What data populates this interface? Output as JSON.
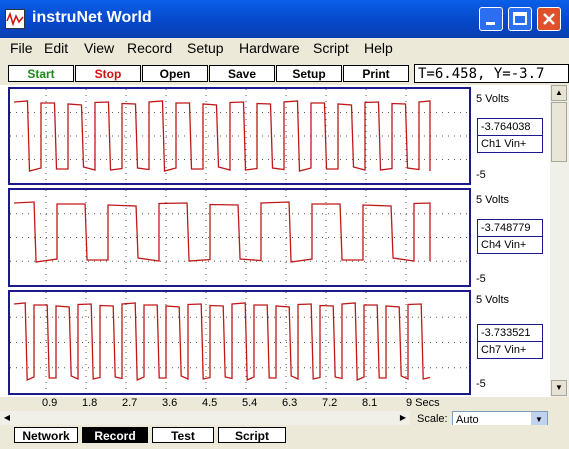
{
  "window": {
    "title": "instruNet World"
  },
  "menu": [
    "File",
    "Edit",
    "View",
    "Record",
    "Setup",
    "Hardware",
    "Script",
    "Help"
  ],
  "toolbar": {
    "buttons": [
      "Start",
      "Stop",
      "Open",
      "Save",
      "Setup",
      "Print"
    ],
    "colors": {
      "start": "#1a8c1a",
      "stop": "#d01010"
    }
  },
  "status_readout": "T=6.458, Y=-3.7",
  "panels": [
    {
      "scale_top": "5 Volts",
      "scale_bottom": "-5",
      "value": "-3.764038",
      "channel": "Ch1 Vin+"
    },
    {
      "scale_top": "5 Volts",
      "scale_bottom": "-5",
      "value": "-3.748779",
      "channel": "Ch4 Vin+"
    },
    {
      "scale_top": "5 Volts",
      "scale_bottom": "-5",
      "value": "-3.733521",
      "channel": "Ch7 Vin+"
    }
  ],
  "x_ticks": [
    "0.9",
    "1.8",
    "2.7",
    "3.6",
    "4.5",
    "5.4",
    "6.3",
    "7.2",
    "8.1",
    "9 Secs"
  ],
  "scale": {
    "label": "Scale:",
    "value": "Auto"
  },
  "tabs": [
    "Network",
    "Record",
    "Test",
    "Script"
  ],
  "trace_color": "#c01818"
}
